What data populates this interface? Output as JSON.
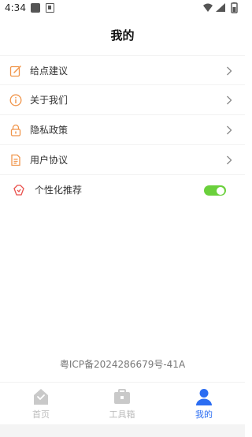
{
  "status_bar": {
    "time": "4:34",
    "icons": [
      "app-icon",
      "notification-icon",
      "wifi-icon",
      "signal-icon",
      "battery-icon"
    ]
  },
  "header": {
    "title": "我的"
  },
  "menu": {
    "items": [
      {
        "label": "给点建议",
        "icon": "edit-icon"
      },
      {
        "label": "关于我们",
        "icon": "info-icon"
      },
      {
        "label": "隐私政策",
        "icon": "lock-icon"
      },
      {
        "label": "用户协议",
        "icon": "document-icon"
      }
    ],
    "toggle": {
      "label": "个性化推荐",
      "icon": "recommend-icon",
      "enabled": true
    }
  },
  "footer": {
    "icp": "粤ICP备2024286679号-41A"
  },
  "tabbar": {
    "tabs": [
      {
        "label": "首页",
        "icon": "home-icon",
        "active": false
      },
      {
        "label": "工具箱",
        "icon": "toolbox-icon",
        "active": false
      },
      {
        "label": "我的",
        "icon": "user-icon",
        "active": true
      }
    ]
  },
  "colors": {
    "icon_orange": "#f0954a",
    "icon_red": "#e9504c",
    "toggle_green": "#6ad03c",
    "active_tab": "#2b6df2",
    "inactive_tab": "#bdbdbd"
  }
}
